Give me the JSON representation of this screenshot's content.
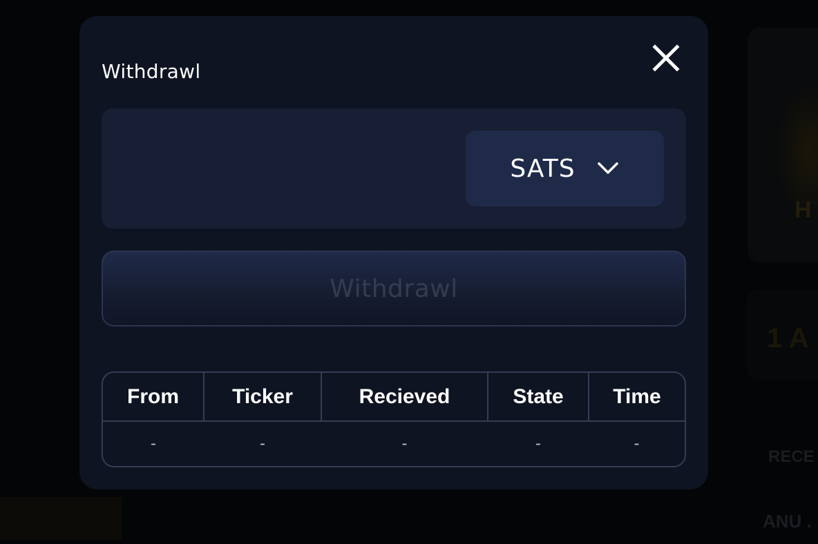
{
  "background": {
    "text_1": "H",
    "text_2": "1 A",
    "text_3": "RECE",
    "text_4": "ANU ."
  },
  "modal": {
    "title": "Withdrawl",
    "close_icon": "close-icon",
    "amount_input": {
      "value": "",
      "placeholder": ""
    },
    "currency": {
      "selected": "SATS",
      "icon": "chevron-down-icon"
    },
    "withdraw_button_label": "Withdrawl",
    "table": {
      "headers": [
        "From",
        "Ticker",
        "Recieved",
        "State",
        "Time"
      ],
      "rows": [
        [
          "-",
          "-",
          "-",
          "-",
          "-"
        ]
      ]
    }
  },
  "colors": {
    "modal_bg": "#0f1422",
    "panel_bg": "#181e33",
    "select_bg": "#1f2a49",
    "button_disabled_text": "#343c52",
    "border": "#363c54"
  }
}
